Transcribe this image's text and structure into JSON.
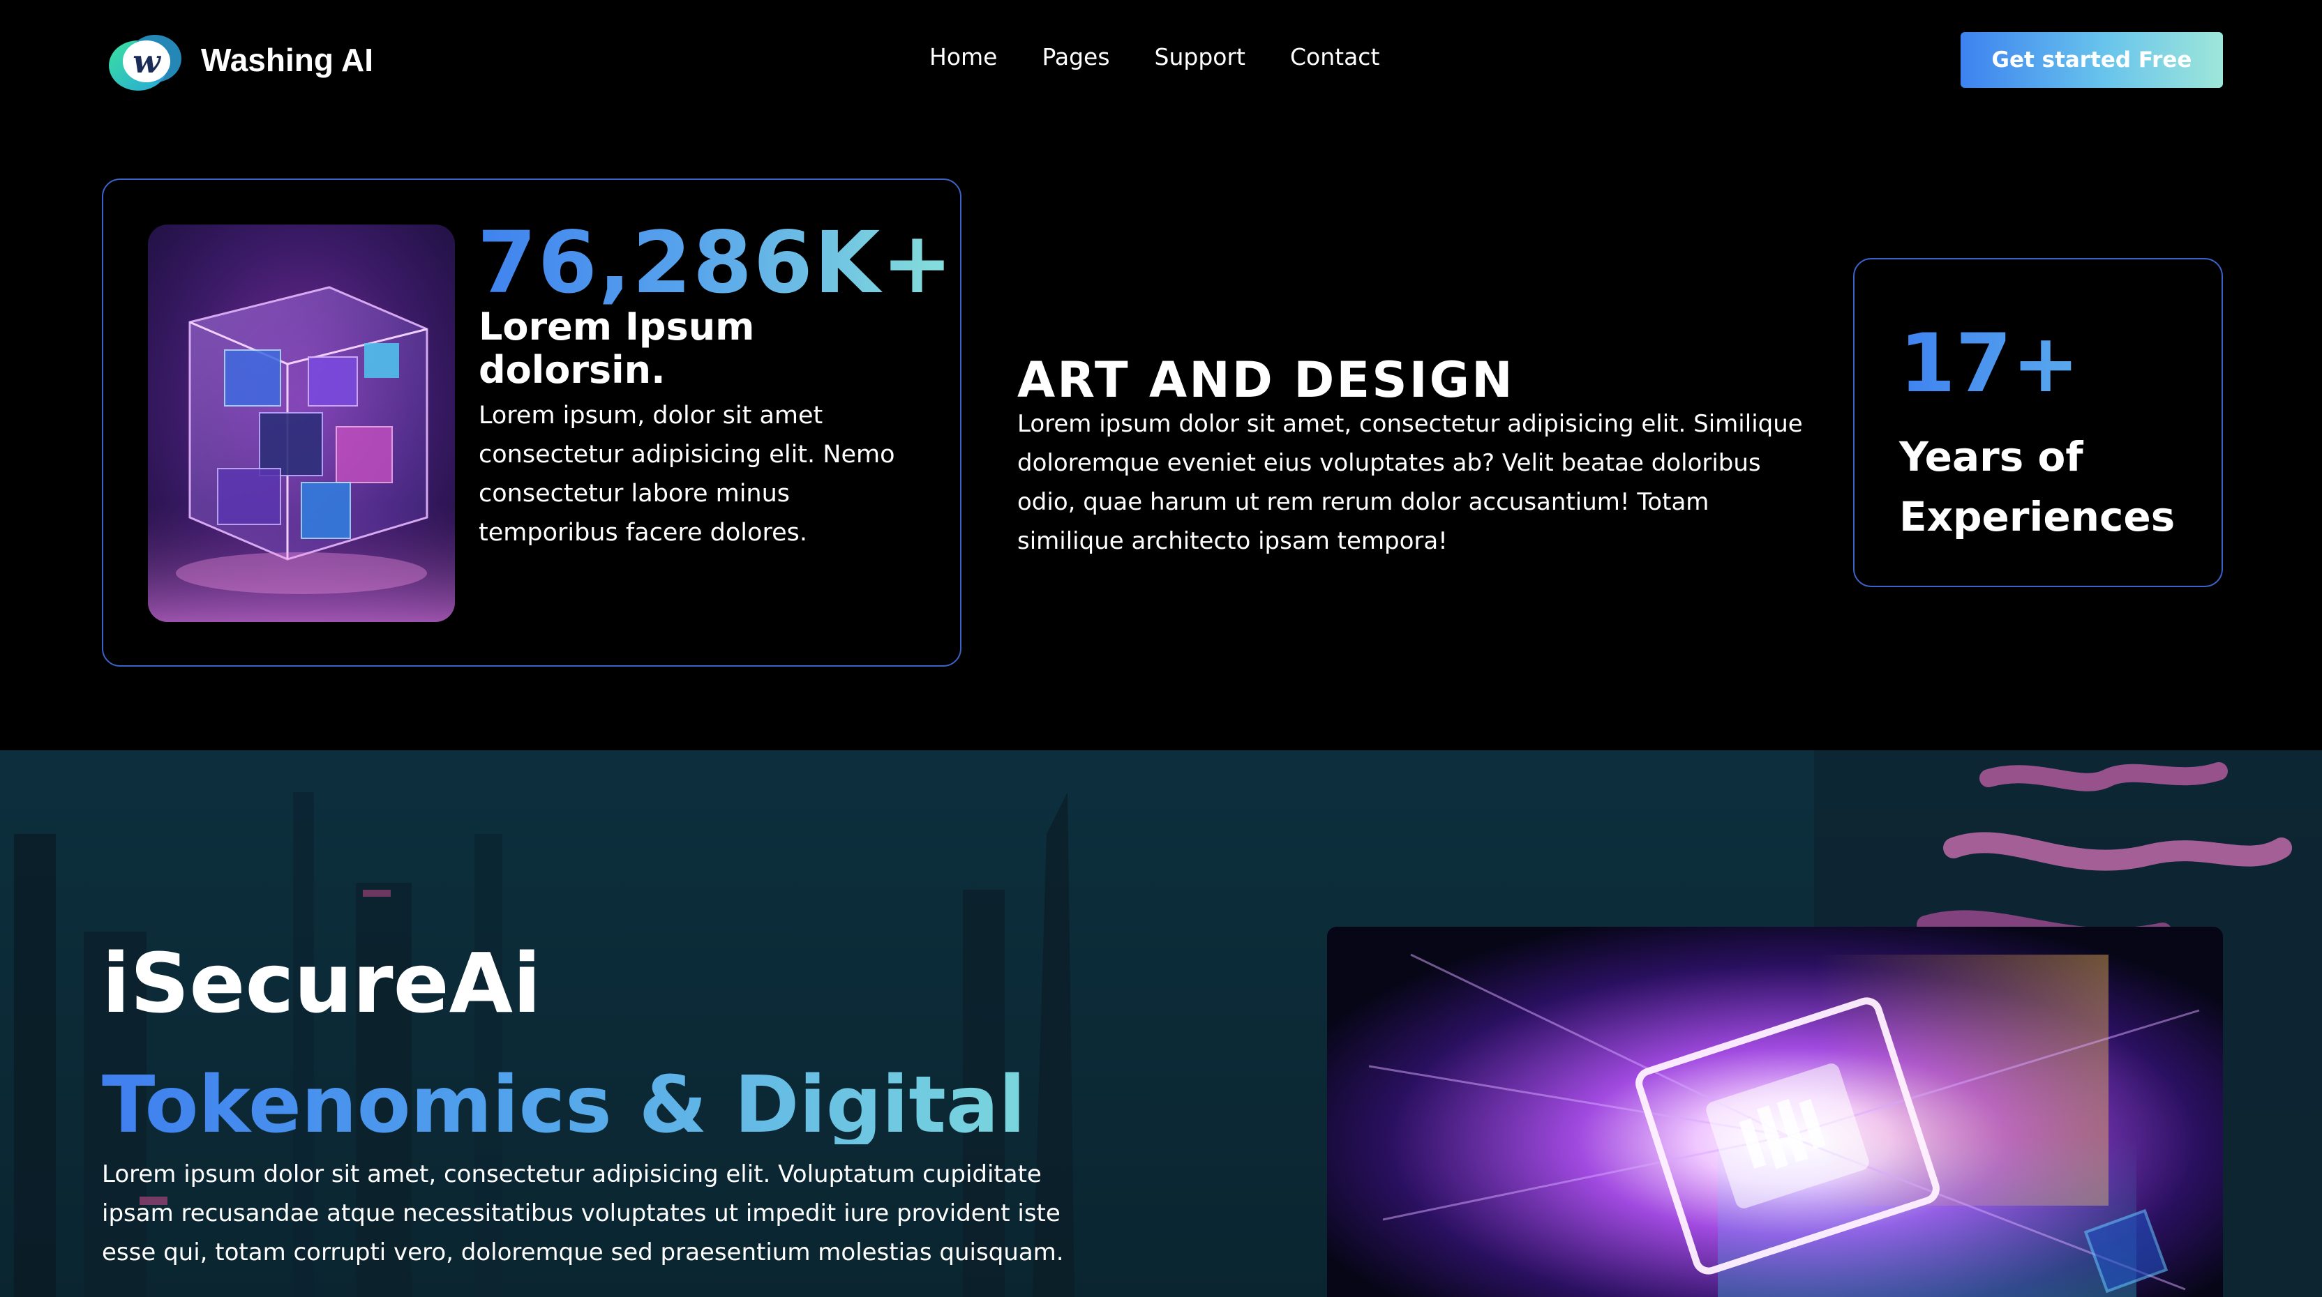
{
  "brand": {
    "name": "Washing AI",
    "logo_icon": "w-letter-logo-icon",
    "logo_colors": [
      "#2fd39b",
      "#2c9bd8",
      "#1a2b57"
    ]
  },
  "nav": {
    "items": [
      {
        "label": "Home"
      },
      {
        "label": "Pages"
      },
      {
        "label": "Support"
      },
      {
        "label": "Contact"
      }
    ],
    "cta_label": "Get started Free"
  },
  "stats_card": {
    "image_icon": "glowing-cube-image",
    "number": "76,286K+",
    "heading": "Lorem Ipsum dolorsin.",
    "body": "Lorem ipsum, dolor sit amet consectetur adipisicing elit. Nemo consectetur labore minus temporibus facere dolores."
  },
  "art": {
    "title": "ART AND DESIGN",
    "body": "Lorem ipsum dolor sit amet, consectetur adipisicing elit. Similique doloremque eveniet eius voluptates ab? Velit beatae doloribus odio, quae harum ut rem rerum dolor accusantium! Totam similique architecto ipsam tempora!"
  },
  "years_card": {
    "number": "17+",
    "label": "Years of Experiences"
  },
  "hero": {
    "title": "iSecureAi",
    "subtitle": "Tokenomics & Digital",
    "body": "Lorem ipsum dolor sit amet, consectetur adipisicing elit. Voluptatum cupiditate ipsam recusandae atque necessitatibus voluptates ut impedit iure provident iste esse qui, totam corrupti vero, doloremque sed praesentium molestias quisquam.",
    "image_icon": "glowing-chip-image"
  },
  "colors": {
    "accent_blue": "#3f82ef",
    "accent_teal": "#86e0da",
    "card_border": "#3c63c8",
    "hero_bg": "#0b2a36"
  }
}
